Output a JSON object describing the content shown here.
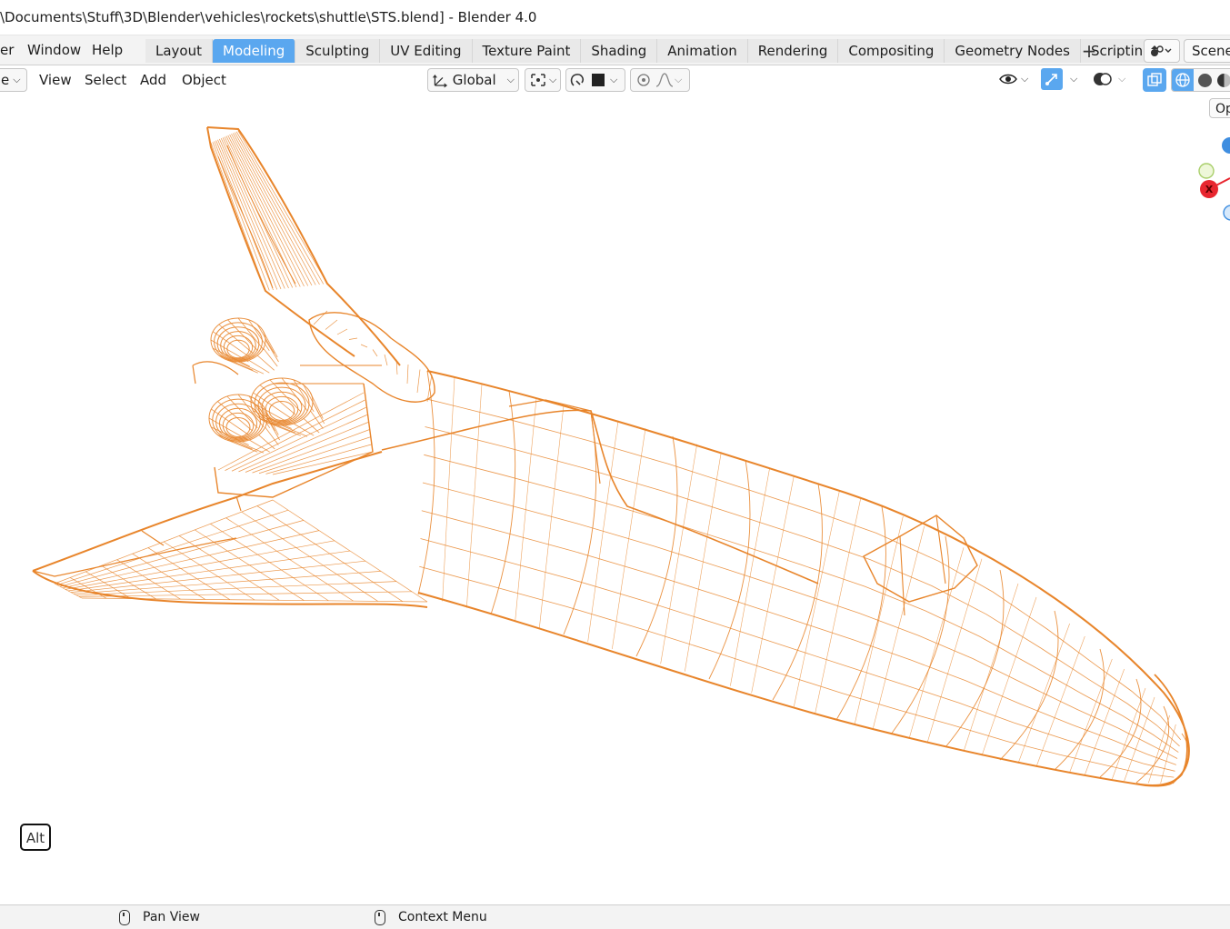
{
  "window": {
    "title": "\\Documents\\Stuff\\3D\\Blender\\vehicles\\rockets\\shuttle\\STS.blend] - Blender 4.0"
  },
  "topbar": {
    "menus": [
      "er",
      "Window",
      "Help"
    ],
    "workspaces": [
      "Layout",
      "Modeling",
      "Sculpting",
      "UV Editing",
      "Texture Paint",
      "Shading",
      "Animation",
      "Rendering",
      "Compositing",
      "Geometry Nodes",
      "Scripting"
    ],
    "active_workspace": "Modeling",
    "add_workspace_label": "+",
    "scene_name": "Scene"
  },
  "header": {
    "mode_label": "e",
    "menus": [
      "View",
      "Select",
      "Add",
      "Object"
    ],
    "orientation": "Global"
  },
  "viewport": {
    "options_label": "Op",
    "gizmo_x_label": "X",
    "alt_key_label": "Alt",
    "wireframe_color": "#e8852b"
  },
  "statusbar": {
    "pan_view": "Pan View",
    "context_menu": "Context Menu"
  },
  "colors": {
    "accent": "#5aa7ef",
    "axis_x": "#e8262f",
    "axis_y": "#8bc34a",
    "axis_z": "#3f8ee0"
  }
}
